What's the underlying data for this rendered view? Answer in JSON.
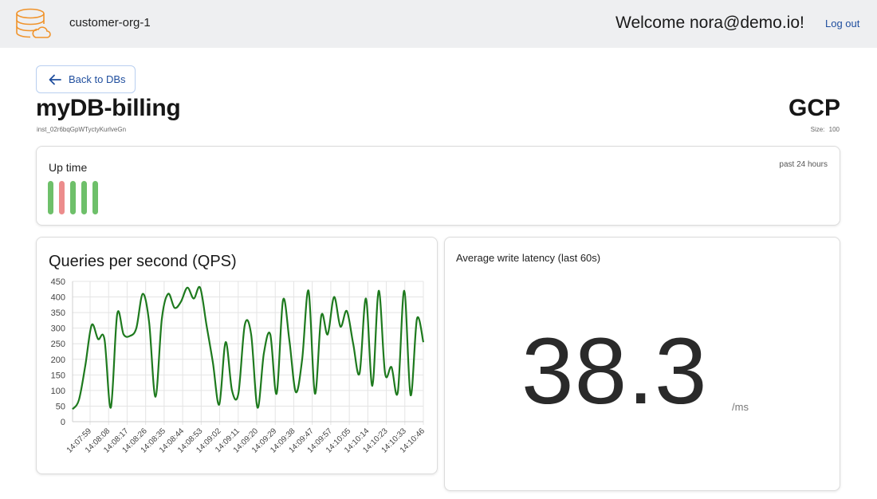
{
  "header": {
    "org_name": "customer-org-1",
    "welcome": "Welcome nora@demo.io!",
    "logout_label": "Log out",
    "logo_icon": "database-cloud-icon",
    "logo_color": "#f0932b"
  },
  "back_button": {
    "label": "Back to DBs",
    "icon": "arrow-left-icon"
  },
  "db": {
    "name": "myDB-billing",
    "id": "inst_02r6bqGpWTyctyKurlveGn",
    "cloud": "GCP",
    "size_label": "Size:",
    "size_value": "100"
  },
  "uptime": {
    "title": "Up time",
    "range": "past 24 hours",
    "statuses": [
      "up",
      "down",
      "up",
      "up",
      "up"
    ],
    "colors": {
      "up": "#6ec06a",
      "down": "#ec8c8c"
    }
  },
  "qps": {
    "title": "Queries per second (QPS)"
  },
  "latency": {
    "title": "Average write latency (last 60s)",
    "value": "38.3",
    "unit": "/ms"
  },
  "chart_data": {
    "type": "line",
    "title": "Queries per second (QPS)",
    "ylim": [
      0,
      450
    ],
    "yticks": [
      0,
      50,
      100,
      150,
      200,
      250,
      300,
      350,
      400,
      450
    ],
    "xticks": [
      "14:07:59",
      "14:08:08",
      "14:08:17",
      "14:08:26",
      "14:08:35",
      "14:08:44",
      "14:08:53",
      "14:09:02",
      "14:09:11",
      "14:09:20",
      "14:09:29",
      "14:09:38",
      "14:09:47",
      "14:09:57",
      "14:10:05",
      "14:10:14",
      "14:10:23",
      "14:10:33",
      "14:10:46"
    ],
    "grid": true,
    "line_color": "#1e7a1e",
    "series": [
      {
        "values": [
          40,
          70,
          180,
          310,
          265,
          265,
          45,
          345,
          280,
          275,
          300,
          410,
          320,
          80,
          330,
          410,
          365,
          385,
          430,
          395,
          430,
          310,
          190,
          55,
          255,
          100,
          90,
          310,
          280,
          45,
          220,
          280,
          90,
          390,
          260,
          95,
          200,
          420,
          90,
          340,
          280,
          400,
          305,
          355,
          250,
          155,
          395,
          115,
          420,
          155,
          175,
          95,
          420,
          85,
          330,
          255
        ]
      }
    ]
  }
}
